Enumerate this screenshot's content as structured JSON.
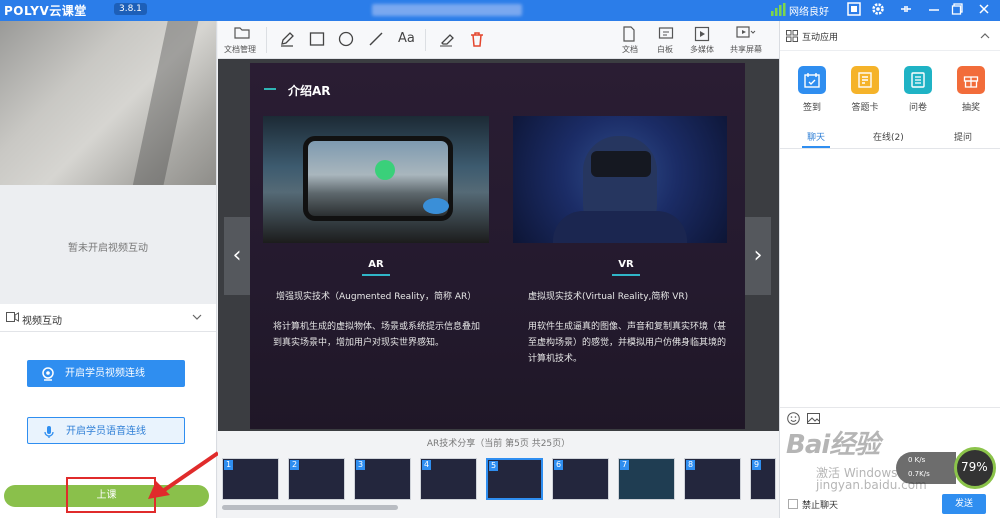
{
  "titlebar": {
    "logo": "POLYV云课堂",
    "version": "3.8.1",
    "network_status": "网络良好",
    "icons": [
      "signal-icon",
      "record-icon",
      "settings-icon",
      "collapse-icon",
      "minimize-icon",
      "maximize-icon",
      "close-icon"
    ]
  },
  "left": {
    "no_video_text": "暂未开启视频互动",
    "video_interaction_label": "视频互动",
    "start_video_button": "开启学员视频连线",
    "start_voice_button": "开启学员语音连线",
    "start_class_button": "上课"
  },
  "toolbar": {
    "doc_manage": "文档管理",
    "text_tool": "Aa",
    "doc": "文档",
    "whiteboard": "白板",
    "multimedia": "多媒体",
    "screen_share": "共享屏幕"
  },
  "slide": {
    "title": "介绍AR",
    "ar": {
      "heading": "AR",
      "subtitle": "增强现实技术（Augmented Reality，简称 AR）",
      "body": "将计算机生成的虚拟物体、场景或系统提示信息叠加到真实场景中，增加用户对现实世界感知。"
    },
    "vr": {
      "heading": "VR",
      "subtitle": "虚拟现实技术(Virtual Reality,简称 VR)",
      "body": "用软件生成逼真的图像、声音和复制真实环境（甚至虚构场景）的感觉，并模拟用户仿佛身临其境的计算机技术。"
    }
  },
  "thumbnails": {
    "caption": "AR技术分享（当前 第5页 共25页）",
    "current_page": 5,
    "total_pages": 25,
    "pages": [
      "1",
      "2",
      "3",
      "4",
      "5",
      "6",
      "7",
      "8",
      "9"
    ]
  },
  "right": {
    "app_header": "互动应用",
    "apps": [
      "签到",
      "答题卡",
      "问卷",
      "抽奖"
    ],
    "app_colors": [
      "#2f8ef0",
      "#f5b32a",
      "#1fb3c5",
      "#f26c3a"
    ],
    "chat_tabs": [
      "聊天",
      "在线(2)",
      "提问"
    ],
    "mute_label": "禁止聊天",
    "send_button": "发送"
  },
  "watermark": {
    "brand": "Bai经验",
    "activate": "激活 Windows",
    "url": "jingyan.baidu.com"
  },
  "speed": {
    "percent": "79%",
    "up": "0 K/s",
    "down": "0.7K/s"
  },
  "colors": {
    "primary": "#2f8ef0",
    "titlebar": "#2b7de9",
    "start_class": "#8ac04b",
    "annotation_red": "#e02b2b"
  }
}
